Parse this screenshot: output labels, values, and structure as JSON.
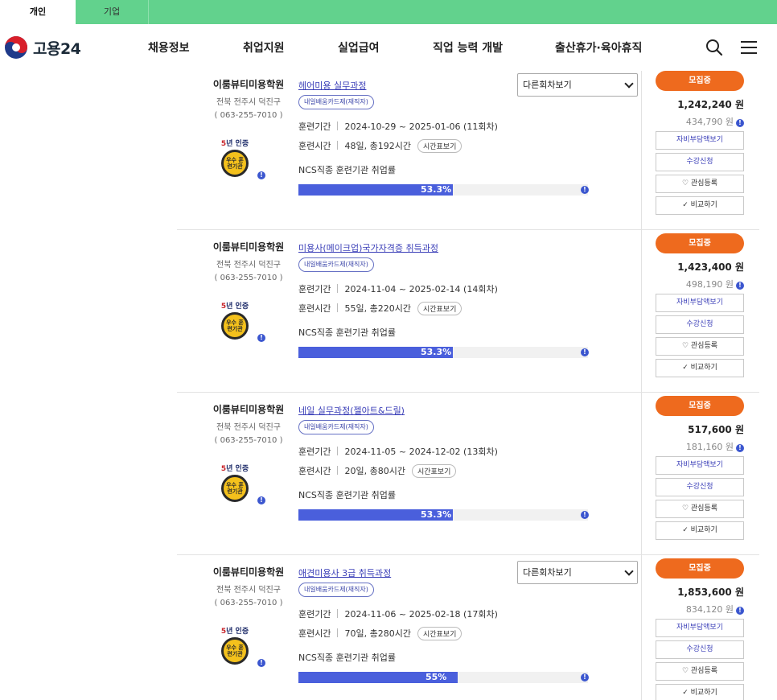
{
  "tabs": [
    {
      "label": "개인",
      "active": true
    },
    {
      "label": "기업",
      "active": false
    }
  ],
  "header": {
    "logo_text": "고용24",
    "nav": [
      "채용정보",
      "취업지원",
      "실업급여",
      "직업 능력 개발",
      "출산휴가·육아휴직"
    ]
  },
  "colors": {
    "top_bar": "#62d28d",
    "status_button": "#ee6a1e",
    "progress_fill": "#4a5fdc",
    "link": "#3b3fb8"
  },
  "labels": {
    "period": "훈련기간",
    "hours": "훈련시간",
    "timetable": "시간표보기",
    "ncs": "NCS직종 훈련기관 취업률",
    "other_round": "다른회차보기",
    "status": "모집중",
    "self_pay": "자비부담액보기",
    "apply": "수강신청",
    "wishlist": "관심등록",
    "compare": "비교하기",
    "cert_label": "5년 인증",
    "cert_seal": "우수 훈련기관"
  },
  "courses": [
    {
      "institute": "이룸뷰티미용학원",
      "address": "전북 전주시 덕진구",
      "phone": "( 063-255-7010 )",
      "title": "헤어미용 실무과정",
      "badge": "내일배움카드제(재직자)",
      "period": "2024-10-29 ~ 2025-01-06 (11회차)",
      "hours": "48일, 총192시간",
      "rate_text": "53.3%",
      "rate": 53.3,
      "show_select": true,
      "price": "1,242,240 원",
      "subprice": "434,790 원"
    },
    {
      "institute": "이룸뷰티미용학원",
      "address": "전북 전주시 덕진구",
      "phone": "( 063-255-7010 )",
      "title": "미용사(메이크업)국가자격증 취득과정",
      "badge": "내일배움카드제(재직자)",
      "period": "2024-11-04 ~ 2025-02-14 (14회차)",
      "hours": "55일, 총220시간",
      "rate_text": "53.3%",
      "rate": 53.3,
      "show_select": false,
      "price": "1,423,400 원",
      "subprice": "498,190 원"
    },
    {
      "institute": "이룸뷰티미용학원",
      "address": "전북 전주시 덕진구",
      "phone": "( 063-255-7010 )",
      "title": "네일 실무과정(젤아트&드릴)",
      "badge": "내일배움카드제(재직자)",
      "period": "2024-11-05 ~ 2024-12-02 (13회차)",
      "hours": "20일, 총80시간",
      "rate_text": "53.3%",
      "rate": 53.3,
      "show_select": false,
      "price": "517,600 원",
      "subprice": "181,160 원"
    },
    {
      "institute": "이룸뷰티미용학원",
      "address": "전북 전주시 덕진구",
      "phone": "( 063-255-7010 )",
      "title": "애견미용사 3급 취득과정",
      "badge": "내일배움카드제(재직자)",
      "period": "2024-11-06 ~ 2025-02-18 (17회차)",
      "hours": "70일, 총280시간",
      "rate_text": "55%",
      "rate": 55,
      "show_select": true,
      "price": "1,853,600 원",
      "subprice": "834,120 원"
    }
  ]
}
